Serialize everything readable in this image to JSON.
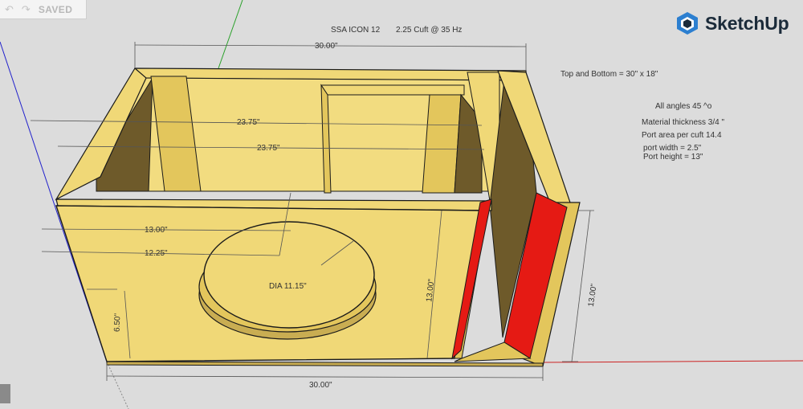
{
  "toolbar": {
    "undo_icon": "undo-icon",
    "redo_icon": "redo-icon",
    "status": "SAVED"
  },
  "brand": {
    "name": "SketchUp",
    "icon": "sketchup-cube-icon",
    "color": "#1b2b3a",
    "accent": "#2c7fd0"
  },
  "title": {
    "model": "SSA ICON 12",
    "spec": "2.25 Cuft @ 35 Hz"
  },
  "notes": {
    "top_bottom": "Top and Bottom = 30\" x 18\"",
    "angles": "All angles 45 ^o",
    "material": "Material thickness 3/4 \"",
    "port_area": "Port area per cuft 14.4",
    "port_width": "port width = 2.5\"",
    "port_height": "Port height = 13\""
  },
  "dimensions": {
    "top_width": "30.00\"",
    "inner_back": "23.75\"",
    "inner_front": "23.75\"",
    "depth_top": "13.00\"",
    "depth_bottom": "12.25\"",
    "sub_offset": "6.50\"",
    "front_height": "13.00\"",
    "side_height": "13.00\"",
    "bottom_width": "30.00\"",
    "diameter": "DIA 11.15\""
  },
  "colors": {
    "wood": "#f0d877",
    "wood_dark": "#e3c65c",
    "wood_shadow": "#c9ad52",
    "interior_shadow": "#6e5a2a",
    "port_red": "#e51a14",
    "outline": "#1a1a1a"
  }
}
